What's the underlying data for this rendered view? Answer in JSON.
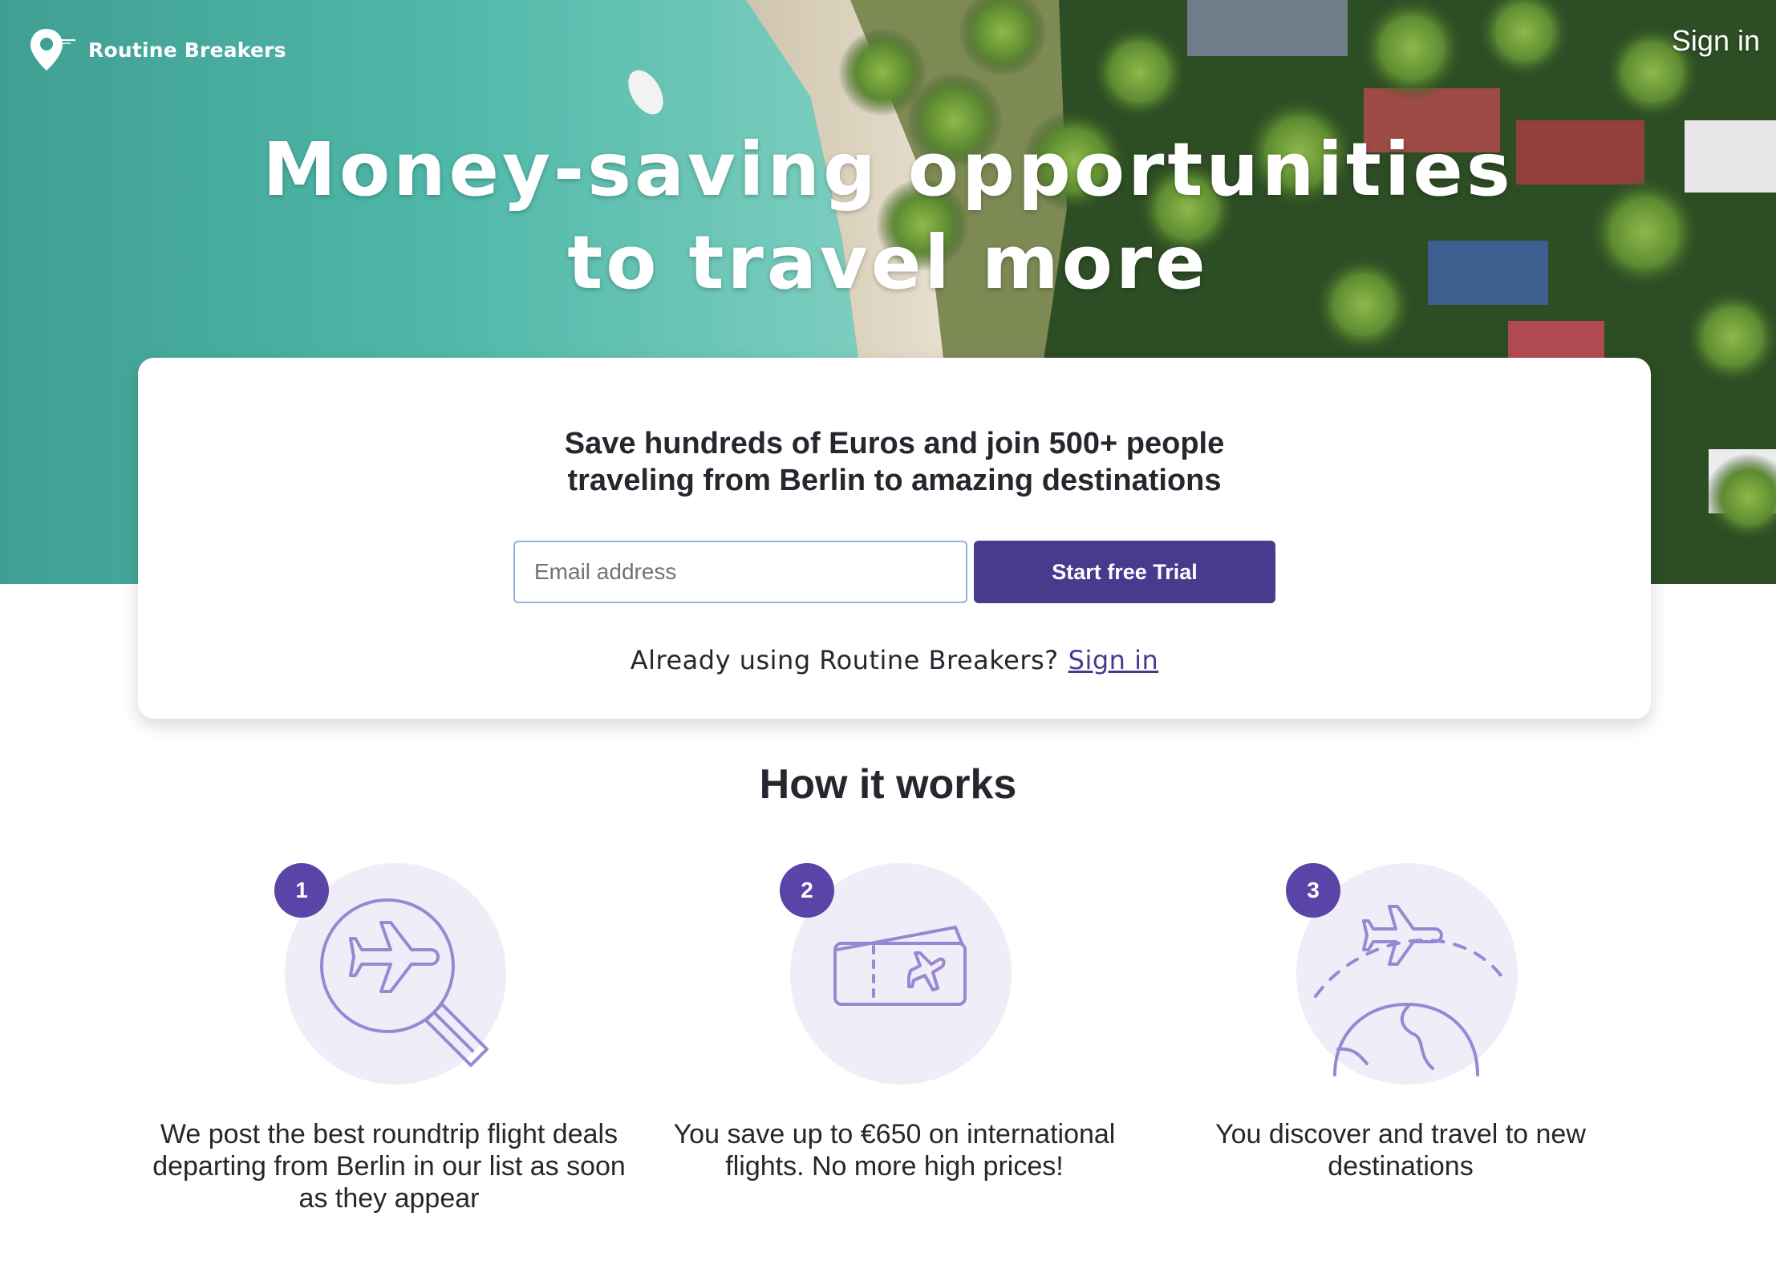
{
  "brand": {
    "name": "Routine Breakers",
    "logo_icon": "map-pin-icon"
  },
  "nav": {
    "signin_label": "Sign in"
  },
  "hero": {
    "title_line1": "Money-saving opportunities",
    "title_line2": "to travel more"
  },
  "signup": {
    "headline_line1": "Save hundreds of Euros and join 500+ people",
    "headline_line2": "traveling from Berlin to amazing destinations",
    "email_placeholder": "Email address",
    "email_value": "",
    "cta_label": "Start free Trial",
    "already_text": "Already using Routine Breakers?",
    "signin_link": "Sign in"
  },
  "how_it_works": {
    "title": "How it works",
    "steps": [
      {
        "number": "1",
        "icon": "search-plane-icon",
        "text": "We post the best roundtrip flight deals departing from Berlin in our list as soon as they appear"
      },
      {
        "number": "2",
        "icon": "ticket-icon",
        "text": "You save up to €650 on international flights. No more high prices!"
      },
      {
        "number": "3",
        "icon": "globe-plane-icon",
        "text": "You discover and travel to new destinations"
      }
    ]
  },
  "colors": {
    "accent": "#4a3a8e",
    "badge": "#5a44a8",
    "icon_stroke": "#9a87d3",
    "circle_bg": "#efedf7",
    "sea": "#3aa89c",
    "jungle": "#35562a"
  }
}
